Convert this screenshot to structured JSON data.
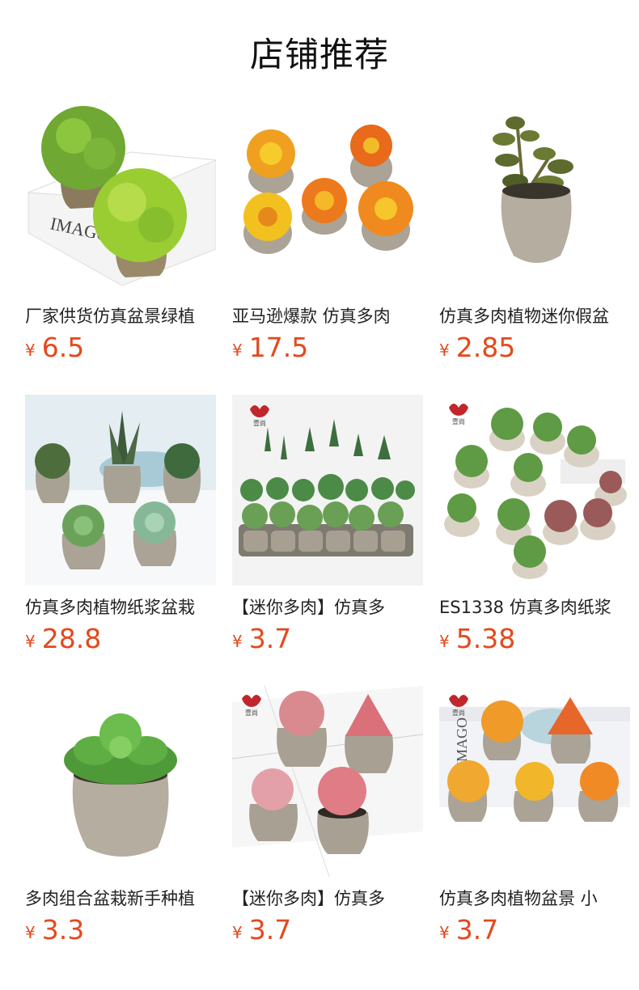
{
  "page_title": "店铺推荐",
  "currency_symbol": "¥",
  "products": [
    {
      "title": "厂家供货仿真盆景绿植",
      "price": "6.5",
      "image": "two-round-green-topiary-on-imago-book"
    },
    {
      "title": "亚马逊爆款 仿真多肉",
      "price": "17.5",
      "image": "five-orange-yellow-succulents-in-pots"
    },
    {
      "title": "仿真多肉植物迷你假盆",
      "price": "2.85",
      "image": "single-jade-plant-in-stone-pot"
    },
    {
      "title": "仿真多肉植物纸浆盆栽",
      "price": "28.8",
      "image": "five-green-succulents-on-white-shelf"
    },
    {
      "title": "【迷你多肉】仿真多",
      "price": "3.7",
      "image": "tray-of-many-mini-succulents"
    },
    {
      "title": "ES1338 仿真多肉纸浆",
      "price": "5.38",
      "image": "assorted-succulents-in-round-pots"
    },
    {
      "title": "多肉组合盆栽新手种植",
      "price": "3.3",
      "image": "green-echeveria-in-stone-pot"
    },
    {
      "title": "【迷你多肉】仿真多",
      "price": "3.7",
      "image": "four-pink-succulents-in-pots"
    },
    {
      "title": "仿真多肉植物盆景 小",
      "price": "3.7",
      "image": "five-orange-succulents-on-book"
    }
  ],
  "colors": {
    "price": "#e4491c",
    "pot": "#b3aca0",
    "text": "#222222"
  },
  "brand_mark": "壹尚"
}
